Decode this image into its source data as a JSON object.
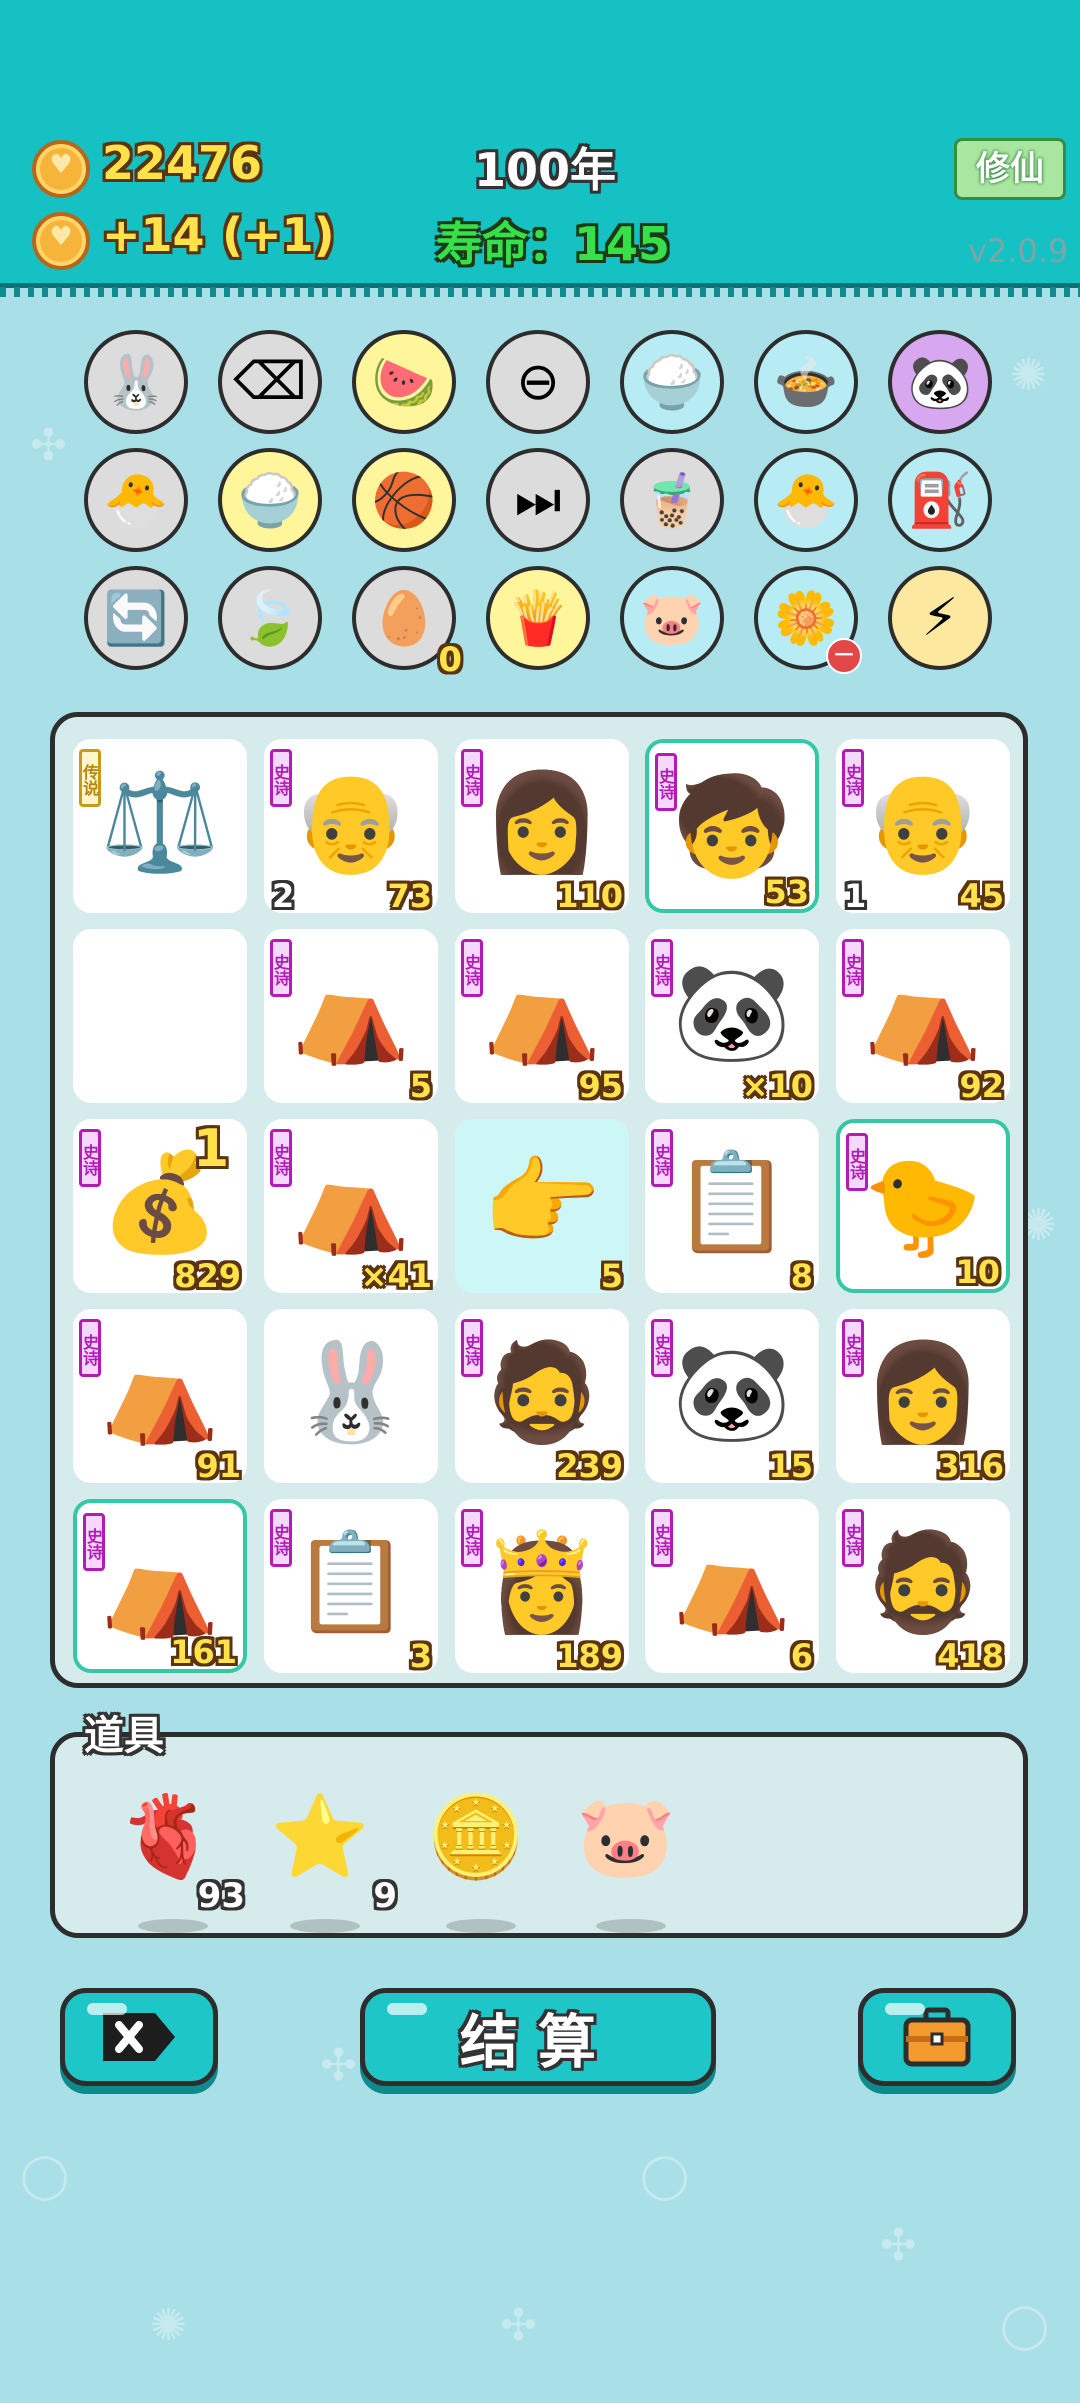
{
  "header": {
    "gold": "22476",
    "income_rate": "+14",
    "income_bonus": "(+1)",
    "year": "100年",
    "lifespan_label": "寿命：",
    "lifespan_value": "145",
    "mode_button": "修仙",
    "version": "v2.0.9"
  },
  "relics": [
    {
      "icon": "rabbit-icon",
      "glyph": "🐰",
      "bg": "#dcdcdc"
    },
    {
      "icon": "delete-tag-icon",
      "glyph": "⌫",
      "bg": "#dcdcdc"
    },
    {
      "icon": "fruit-basket-icon",
      "glyph": "🍉",
      "bg": "#fff59a"
    },
    {
      "icon": "minus-circle-icon",
      "glyph": "⊖",
      "bg": "#dcdcdc"
    },
    {
      "icon": "rice-bowl-icon",
      "glyph": "🍚",
      "bg": "#b7ecf5"
    },
    {
      "icon": "pot-duck-icon",
      "glyph": "🍲",
      "bg": "#b7ecf5"
    },
    {
      "icon": "panda-icon",
      "glyph": "🐼",
      "bg": "#d7a8f0"
    },
    {
      "icon": "chick-egg-icon",
      "glyph": "🐣",
      "bg": "#dcdcdc"
    },
    {
      "icon": "rice-bowl-icon",
      "glyph": "🍚",
      "bg": "#fff59a"
    },
    {
      "icon": "basketballs-icon",
      "glyph": "🏀",
      "bg": "#fff59a"
    },
    {
      "icon": "skip-icon",
      "glyph": "⏭",
      "bg": "#dcdcdc"
    },
    {
      "icon": "bubble-tea-icon",
      "glyph": "🧋",
      "bg": "#dcdcdc"
    },
    {
      "icon": "chick-egg-icon",
      "glyph": "🐣",
      "bg": "#b7ecf5"
    },
    {
      "icon": "pump-icon",
      "glyph": "⛽",
      "bg": "#b7ecf5"
    },
    {
      "icon": "refresh-icon",
      "glyph": "🔄",
      "bg": "#dcdcdc"
    },
    {
      "icon": "leaf-icon",
      "glyph": "🍃",
      "bg": "#dcdcdc"
    },
    {
      "icon": "egg-tray-icon",
      "glyph": "🥚",
      "bg": "#dcdcdc",
      "num": "0"
    },
    {
      "icon": "fries-icon",
      "glyph": "🍟",
      "bg": "#fff59a"
    },
    {
      "icon": "piggy-bank-icon",
      "glyph": "🐷",
      "bg": "#b7ecf5"
    },
    {
      "icon": "flower-pot-icon",
      "glyph": "🌼",
      "bg": "#b7ecf5",
      "minus": "−"
    },
    {
      "icon": "lightning-icon",
      "glyph": "⚡",
      "bg": "#fde8a0"
    }
  ],
  "board": [
    {
      "tag": "传说",
      "tagType": "gold",
      "icon": "scale-icon",
      "glyph": "⚖️",
      "value": "",
      "count": ""
    },
    {
      "tag": "史诗",
      "icon": "grandpa-heart-eyes-icon",
      "glyph": "👴",
      "value": "73",
      "count": "2"
    },
    {
      "tag": "史诗",
      "icon": "girl-braids-icon",
      "glyph": "👩",
      "value": "110",
      "count": ""
    },
    {
      "tag": "史诗",
      "icon": "boy-red-cap-icon",
      "glyph": "🧒",
      "value": "53",
      "count": "",
      "hl": true
    },
    {
      "tag": "史诗",
      "icon": "grandpa-glasses-icon",
      "glyph": "👴",
      "value": "45",
      "count": "1"
    },
    {
      "tag": "",
      "icon": "empty-slot",
      "glyph": "",
      "value": "",
      "count": ""
    },
    {
      "tag": "史诗",
      "icon": "rabbit-tent-icon",
      "glyph": "⛺",
      "value": "5",
      "count": ""
    },
    {
      "tag": "史诗",
      "icon": "rabbit-tent-icon",
      "glyph": "⛺",
      "value": "95",
      "count": ""
    },
    {
      "tag": "史诗",
      "icon": "panda-icon",
      "glyph": "🐼",
      "value": "×10",
      "count": ""
    },
    {
      "tag": "史诗",
      "icon": "rabbit-tent-icon",
      "glyph": "⛺",
      "value": "92",
      "count": ""
    },
    {
      "tag": "史诗",
      "icon": "coin-stack-icon",
      "glyph": "💰",
      "value": "829",
      "count": "",
      "extra": "1"
    },
    {
      "tag": "史诗",
      "icon": "rabbit-tent-icon",
      "glyph": "⛺",
      "value": "×41",
      "count": ""
    },
    {
      "tag": "",
      "icon": "pointing-hand-icon",
      "glyph": "👉",
      "value": "5",
      "count": "",
      "cyan": true
    },
    {
      "tag": "史诗",
      "icon": "copy-paste-icon",
      "glyph": "📋",
      "value": "8",
      "count": ""
    },
    {
      "tag": "史诗",
      "icon": "old-bird-icon",
      "glyph": "🐤",
      "value": "10",
      "count": "",
      "hl": true
    },
    {
      "tag": "史诗",
      "icon": "rabbit-tent-icon",
      "glyph": "⛺",
      "value": "91",
      "count": ""
    },
    {
      "tag": "",
      "icon": "rabbit-icon",
      "glyph": "🐰",
      "value": "",
      "count": ""
    },
    {
      "tag": "史诗",
      "icon": "bearded-man-icon",
      "glyph": "🧔",
      "value": "239",
      "count": ""
    },
    {
      "tag": "史诗",
      "icon": "panda-icon",
      "glyph": "🐼",
      "value": "15",
      "count": ""
    },
    {
      "tag": "史诗",
      "icon": "girl-braids-icon",
      "glyph": "👩",
      "value": "316",
      "count": ""
    },
    {
      "tag": "史诗",
      "icon": "rabbit-tent-icon",
      "glyph": "⛺",
      "value": "161",
      "count": "",
      "hl": true
    },
    {
      "tag": "史诗",
      "icon": "copy-paste-icon",
      "glyph": "📋",
      "value": "3",
      "count": ""
    },
    {
      "tag": "史诗",
      "icon": "queen-icon",
      "glyph": "👸",
      "value": "189",
      "count": ""
    },
    {
      "tag": "史诗",
      "icon": "rabbit-tent-icon",
      "glyph": "⛺",
      "value": "6",
      "count": ""
    },
    {
      "tag": "史诗",
      "icon": "bearded-man-icon",
      "glyph": "🧔",
      "value": "418",
      "count": ""
    }
  ],
  "items": {
    "title": "道具",
    "list": [
      {
        "icon": "liver-icon",
        "glyph": "🫀",
        "qty": "93"
      },
      {
        "icon": "star-icon",
        "glyph": "⭐",
        "qty": "9"
      },
      {
        "icon": "dollar-coin-icon",
        "glyph": "🪙",
        "qty": ""
      },
      {
        "icon": "piggy-bank-icon",
        "glyph": "🐷",
        "qty": ""
      }
    ]
  },
  "buttons": {
    "settle": "结算"
  },
  "colors": {
    "header": "#16c1c4",
    "board": "#d6ecec",
    "background": "#a9dfe6",
    "accent": "#1fc6c8"
  }
}
